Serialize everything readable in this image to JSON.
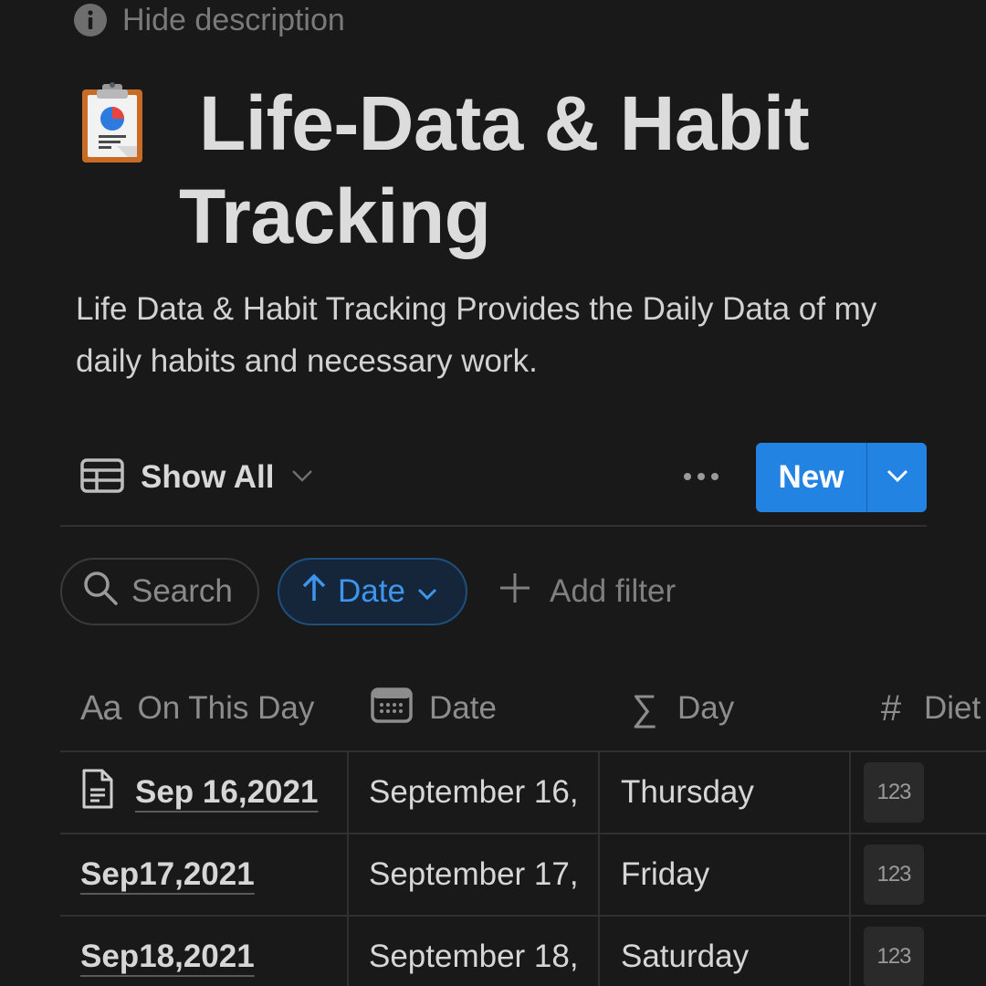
{
  "header": {
    "hide_description": "Hide description",
    "icon": "clipboard-chart-emoji-icon",
    "title": "Life-Data & Habit Tracking",
    "description": "Life Data & Habit Tracking Provides the Daily Data of my daily habits and necessary work."
  },
  "viewbar": {
    "view_name": "Show All",
    "view_icon": "table-icon",
    "more_icon": "more-dots-icon",
    "new_label": "New",
    "accent": "#2383e2"
  },
  "filters": {
    "search_label": "Search",
    "sort_label": "Date",
    "sort_direction": "ascending",
    "add_filter_label": "Add filter"
  },
  "table": {
    "columns": [
      {
        "label": "On This Day",
        "icon": "title-aa-icon"
      },
      {
        "label": "Date",
        "icon": "calendar-icon"
      },
      {
        "label": "Day",
        "icon": "formula-sigma-icon"
      },
      {
        "label": "Diet",
        "icon": "number-hash-icon"
      }
    ],
    "rows": [
      {
        "title": "Sep 16,2021",
        "has_page_icon": true,
        "date": "September 16,",
        "day": "Thursday",
        "number_placeholder": "123"
      },
      {
        "title": "Sep17,2021",
        "has_page_icon": false,
        "date": "September 17,",
        "day": "Friday",
        "number_placeholder": "123"
      },
      {
        "title": "Sep18,2021",
        "has_page_icon": false,
        "date": "September 18,",
        "day": "Saturday",
        "number_placeholder": "123"
      }
    ]
  }
}
